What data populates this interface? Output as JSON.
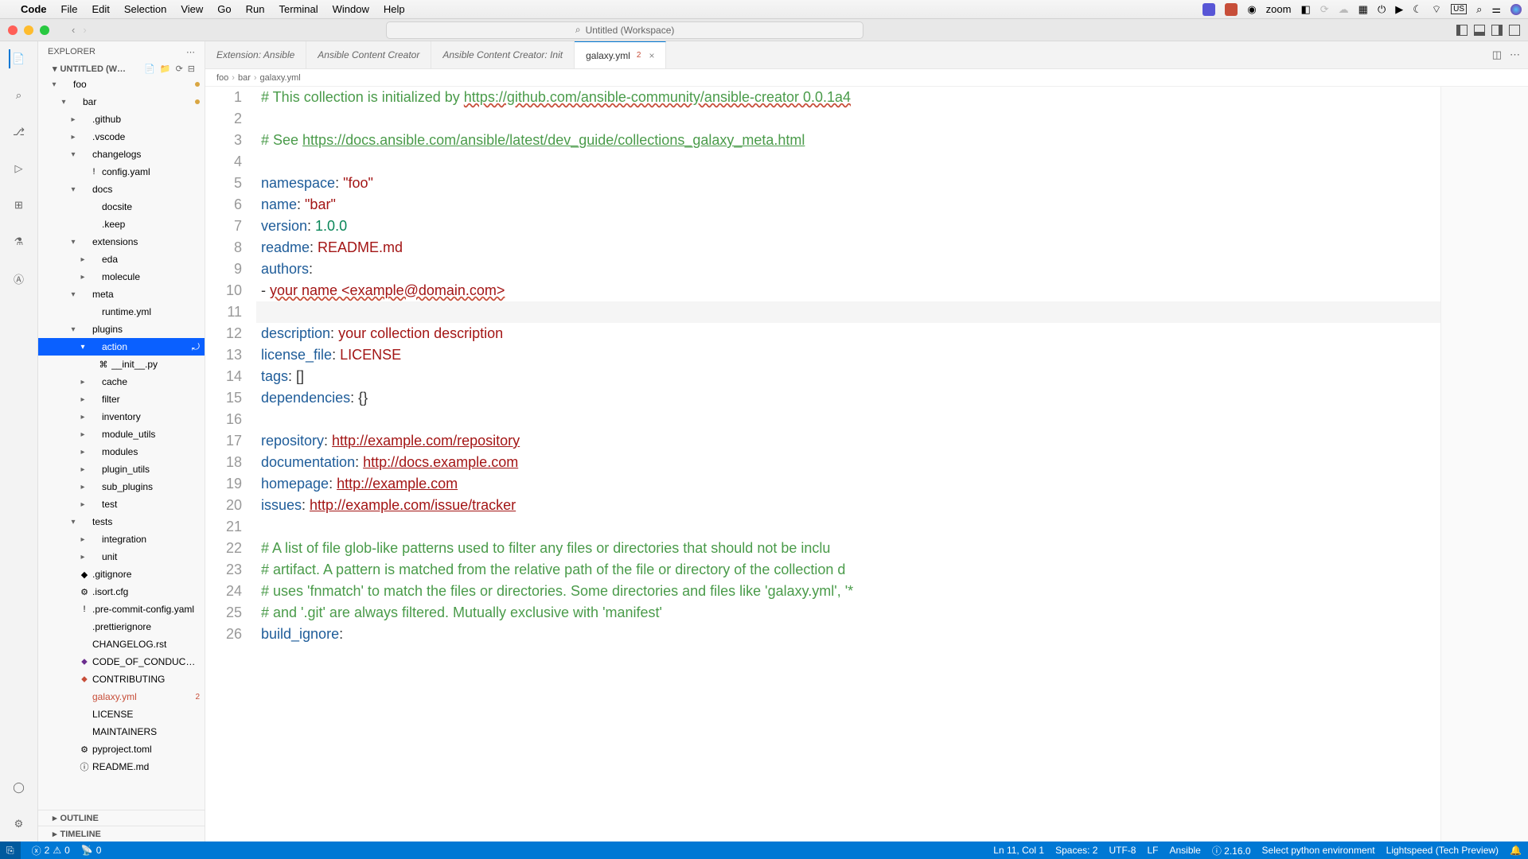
{
  "menubar": {
    "app": "Code",
    "items": [
      "File",
      "Edit",
      "Selection",
      "View",
      "Go",
      "Run",
      "Terminal",
      "Window",
      "Help"
    ],
    "zoom": "zoom",
    "date": "",
    "tray_labels": [
      "US"
    ]
  },
  "titlebar": {
    "search_label": "Untitled (Workspace)"
  },
  "sidebar": {
    "header": "EXPLORER",
    "workspace": "UNTITLED (W…",
    "tree": [
      {
        "d": 0,
        "chev": "▾",
        "label": "foo",
        "mod": true,
        "icon": ""
      },
      {
        "d": 1,
        "chev": "▾",
        "label": "bar",
        "mod": true,
        "icon": ""
      },
      {
        "d": 2,
        "chev": "▸",
        "label": ".github",
        "icon": ""
      },
      {
        "d": 2,
        "chev": "▸",
        "label": ".vscode",
        "icon": ""
      },
      {
        "d": 2,
        "chev": "▾",
        "label": "changelogs",
        "icon": ""
      },
      {
        "d": 3,
        "chev": "",
        "label": "config.yaml",
        "icon": "!"
      },
      {
        "d": 2,
        "chev": "▾",
        "label": "docs",
        "icon": ""
      },
      {
        "d": 3,
        "chev": "",
        "label": "docsite",
        "icon": ""
      },
      {
        "d": 3,
        "chev": "",
        "label": ".keep",
        "icon": ""
      },
      {
        "d": 2,
        "chev": "▾",
        "label": "extensions",
        "icon": ""
      },
      {
        "d": 3,
        "chev": "▸",
        "label": "eda",
        "icon": ""
      },
      {
        "d": 3,
        "chev": "▸",
        "label": "molecule",
        "icon": ""
      },
      {
        "d": 2,
        "chev": "▾",
        "label": "meta",
        "icon": ""
      },
      {
        "d": 3,
        "chev": "",
        "label": "runtime.yml",
        "icon": ""
      },
      {
        "d": 2,
        "chev": "▾",
        "label": "plugins",
        "icon": ""
      },
      {
        "d": 3,
        "chev": "▾",
        "label": "action",
        "icon": "",
        "selected": true,
        "cursor": true
      },
      {
        "d": 4,
        "chev": "",
        "label": "__init__.py",
        "icon": "⌘"
      },
      {
        "d": 3,
        "chev": "▸",
        "label": "cache",
        "icon": ""
      },
      {
        "d": 3,
        "chev": "▸",
        "label": "filter",
        "icon": ""
      },
      {
        "d": 3,
        "chev": "▸",
        "label": "inventory",
        "icon": ""
      },
      {
        "d": 3,
        "chev": "▸",
        "label": "module_utils",
        "icon": ""
      },
      {
        "d": 3,
        "chev": "▸",
        "label": "modules",
        "icon": ""
      },
      {
        "d": 3,
        "chev": "▸",
        "label": "plugin_utils",
        "icon": ""
      },
      {
        "d": 3,
        "chev": "▸",
        "label": "sub_plugins",
        "icon": ""
      },
      {
        "d": 3,
        "chev": "▸",
        "label": "test",
        "icon": ""
      },
      {
        "d": 2,
        "chev": "▾",
        "label": "tests",
        "icon": ""
      },
      {
        "d": 3,
        "chev": "▸",
        "label": "integration",
        "icon": ""
      },
      {
        "d": 3,
        "chev": "▸",
        "label": "unit",
        "icon": ""
      },
      {
        "d": 2,
        "chev": "",
        "label": ".gitignore",
        "icon": "◆"
      },
      {
        "d": 2,
        "chev": "",
        "label": ".isort.cfg",
        "icon": "⚙"
      },
      {
        "d": 2,
        "chev": "",
        "label": ".pre-commit-config.yaml",
        "icon": "!"
      },
      {
        "d": 2,
        "chev": "",
        "label": ".prettierignore",
        "icon": ""
      },
      {
        "d": 2,
        "chev": "",
        "label": "CHANGELOG.rst",
        "icon": ""
      },
      {
        "d": 2,
        "chev": "",
        "label": "CODE_OF_CONDUCT.md",
        "icon": "⬥",
        "iconColor": "#6b2e8e"
      },
      {
        "d": 2,
        "chev": "",
        "label": "CONTRIBUTING",
        "icon": "⬥",
        "iconColor": "#c74e39"
      },
      {
        "d": 2,
        "chev": "",
        "label": "galaxy.yml",
        "icon": "",
        "err": "2",
        "errColor": true
      },
      {
        "d": 2,
        "chev": "",
        "label": "LICENSE",
        "icon": ""
      },
      {
        "d": 2,
        "chev": "",
        "label": "MAINTAINERS",
        "icon": ""
      },
      {
        "d": 2,
        "chev": "",
        "label": "pyproject.toml",
        "icon": "⚙"
      },
      {
        "d": 2,
        "chev": "",
        "label": "README.md",
        "icon": "ⓘ"
      }
    ],
    "outline": "OUTLINE",
    "timeline": "TIMELINE"
  },
  "tabs": [
    {
      "label": "Extension: Ansible",
      "active": false
    },
    {
      "label": "Ansible Content Creator",
      "active": false
    },
    {
      "label": "Ansible Content Creator: Init",
      "active": false
    },
    {
      "label": "galaxy.yml",
      "active": true,
      "err": "2",
      "close": true
    }
  ],
  "breadcrumb": [
    "foo",
    "bar",
    "galaxy.yml"
  ],
  "code": {
    "lines": [
      {
        "n": 1,
        "seg": [
          {
            "t": "# This collection is initialized by ",
            "c": "c-comment"
          },
          {
            "t": "https://github.com/ansible-community/ansible-creator 0.0.1a4",
            "c": "c-link squiggle"
          }
        ]
      },
      {
        "n": 2,
        "seg": []
      },
      {
        "n": 3,
        "seg": [
          {
            "t": "# See ",
            "c": "c-comment"
          },
          {
            "t": "https://docs.ansible.com/ansible/latest/dev_guide/collections_galaxy_meta.html",
            "c": "c-link"
          }
        ]
      },
      {
        "n": 4,
        "seg": []
      },
      {
        "n": 5,
        "seg": [
          {
            "t": "namespace",
            "c": "c-key"
          },
          {
            "t": ": "
          },
          {
            "t": "\"foo\"",
            "c": "c-str"
          }
        ]
      },
      {
        "n": 6,
        "seg": [
          {
            "t": "name",
            "c": "c-key"
          },
          {
            "t": ": "
          },
          {
            "t": "\"bar\"",
            "c": "c-str"
          }
        ]
      },
      {
        "n": 7,
        "seg": [
          {
            "t": "version",
            "c": "c-key"
          },
          {
            "t": ": "
          },
          {
            "t": "1.0.0",
            "c": "c-num"
          }
        ]
      },
      {
        "n": 8,
        "seg": [
          {
            "t": "readme",
            "c": "c-key"
          },
          {
            "t": ": "
          },
          {
            "t": "README.md",
            "c": "c-str"
          }
        ]
      },
      {
        "n": 9,
        "seg": [
          {
            "t": "authors",
            "c": "c-key"
          },
          {
            "t": ":"
          }
        ]
      },
      {
        "n": 10,
        "seg": [
          {
            "t": "- "
          },
          {
            "t": "your name <example@domain.com>",
            "c": "c-str squiggle"
          }
        ]
      },
      {
        "n": 11,
        "seg": [],
        "hl": true
      },
      {
        "n": 12,
        "seg": [
          {
            "t": "description",
            "c": "c-key"
          },
          {
            "t": ": "
          },
          {
            "t": "your collection description",
            "c": "c-str"
          }
        ]
      },
      {
        "n": 13,
        "seg": [
          {
            "t": "license_file",
            "c": "c-key"
          },
          {
            "t": ": "
          },
          {
            "t": "LICENSE",
            "c": "c-str"
          }
        ]
      },
      {
        "n": 14,
        "seg": [
          {
            "t": "tags",
            "c": "c-key"
          },
          {
            "t": ": []"
          }
        ]
      },
      {
        "n": 15,
        "seg": [
          {
            "t": "dependencies",
            "c": "c-key"
          },
          {
            "t": ": {}"
          }
        ]
      },
      {
        "n": 16,
        "seg": []
      },
      {
        "n": 17,
        "seg": [
          {
            "t": "repository",
            "c": "c-key"
          },
          {
            "t": ": "
          },
          {
            "t": "http://example.com/repository",
            "c": "c-url"
          }
        ]
      },
      {
        "n": 18,
        "seg": [
          {
            "t": "documentation",
            "c": "c-key"
          },
          {
            "t": ": "
          },
          {
            "t": "http://docs.example.com",
            "c": "c-url"
          }
        ]
      },
      {
        "n": 19,
        "seg": [
          {
            "t": "homepage",
            "c": "c-key"
          },
          {
            "t": ": "
          },
          {
            "t": "http://example.com",
            "c": "c-url"
          }
        ]
      },
      {
        "n": 20,
        "seg": [
          {
            "t": "issues",
            "c": "c-key"
          },
          {
            "t": ": "
          },
          {
            "t": "http://example.com/issue/tracker",
            "c": "c-url"
          }
        ]
      },
      {
        "n": 21,
        "seg": []
      },
      {
        "n": 22,
        "seg": [
          {
            "t": "# A list of file glob-like patterns used to filter any files or directories that should not be inclu",
            "c": "c-comment"
          }
        ]
      },
      {
        "n": 23,
        "seg": [
          {
            "t": "# artifact. A pattern is matched from the relative path of the file or directory of the collection d",
            "c": "c-comment"
          }
        ]
      },
      {
        "n": 24,
        "seg": [
          {
            "t": "# uses 'fnmatch' to match the files or directories. Some directories and files like 'galaxy.yml', '*",
            "c": "c-comment"
          }
        ]
      },
      {
        "n": 25,
        "seg": [
          {
            "t": "# and '.git' are always filtered. Mutually exclusive with 'manifest'",
            "c": "c-comment"
          }
        ]
      },
      {
        "n": 26,
        "seg": [
          {
            "t": "build_ignore",
            "c": "c-key"
          },
          {
            "t": ":"
          }
        ]
      }
    ]
  },
  "statusbar": {
    "errors": "2",
    "warnings": "0",
    "ports": "0",
    "cursor": "Ln 11, Col 1",
    "spaces": "Spaces: 2",
    "encoding": "UTF-8",
    "eol": "LF",
    "lang": "Ansible",
    "ansible_ver": "ⓘ 2.16.0",
    "python": "Select python environment",
    "lightspeed": "Lightspeed (Tech Preview)"
  }
}
